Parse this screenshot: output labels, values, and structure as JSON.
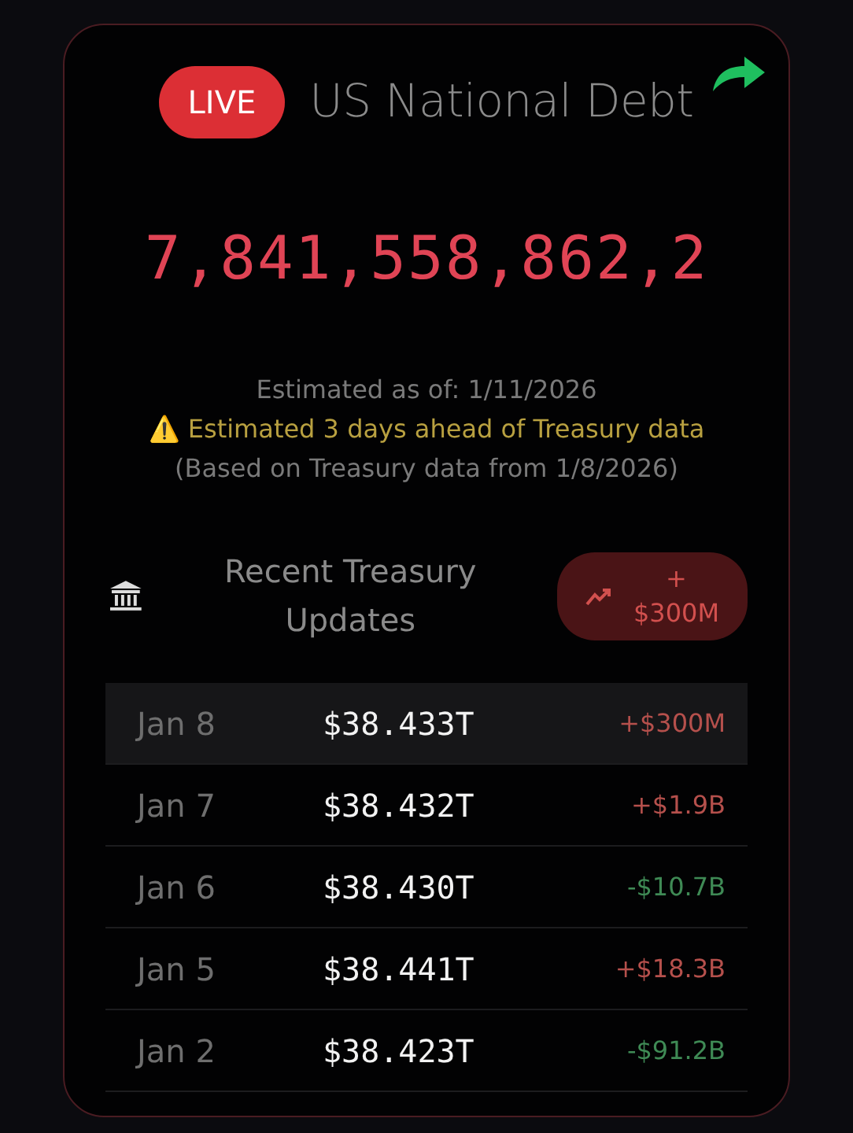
{
  "header": {
    "live_badge": "LIVE",
    "title": "US National Debt"
  },
  "debt_counter": "7,841,558,862,2",
  "estimate": {
    "as_of": "Estimated as of: 1/11/2026",
    "warning_icon": "⚠️",
    "warning": "Estimated 3 days ahead of Treasury data",
    "basis": "(Based on Treasury data from 1/8/2026)"
  },
  "updates": {
    "title": "Recent Treasury Updates",
    "change_badge": {
      "color": "#d2504e",
      "sign": "+",
      "amount": "$300M"
    },
    "rows": [
      {
        "date": "Jan 8",
        "total": "$38.433T",
        "change": "+$300M",
        "color": "#b5504c",
        "selected": true
      },
      {
        "date": "Jan 7",
        "total": "$38.432T",
        "change": "+$1.9B",
        "color": "#b5504c",
        "selected": false
      },
      {
        "date": "Jan 6",
        "total": "$38.430T",
        "change": "-$10.7B",
        "color": "#3f8a55",
        "selected": false
      },
      {
        "date": "Jan 5",
        "total": "$38.441T",
        "change": "+$18.3B",
        "color": "#b5504c",
        "selected": false
      },
      {
        "date": "Jan 2",
        "total": "$38.423T",
        "change": "-$91.2B",
        "color": "#3f8a55",
        "selected": false
      }
    ]
  }
}
